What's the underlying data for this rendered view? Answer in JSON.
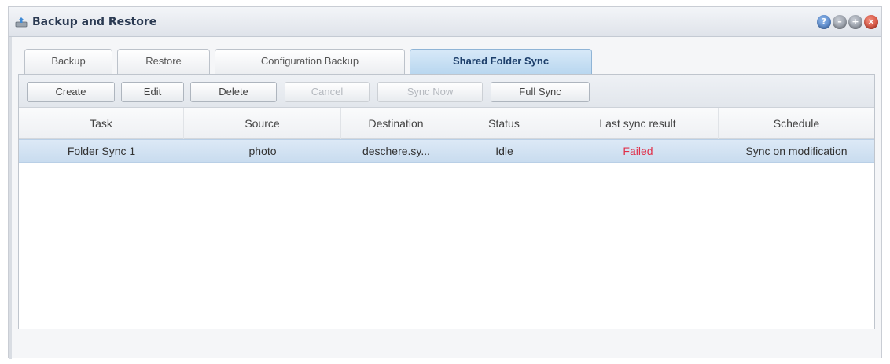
{
  "window": {
    "title": "Backup and Restore"
  },
  "window_buttons": [
    {
      "name": "help-button",
      "glyph": "?"
    },
    {
      "name": "minimize-button",
      "glyph": "–"
    },
    {
      "name": "maximize-button",
      "glyph": "+"
    },
    {
      "name": "close-button",
      "glyph": "×"
    }
  ],
  "tabs": [
    {
      "label": "Backup",
      "active": false
    },
    {
      "label": "Restore",
      "active": false
    },
    {
      "label": "Configuration Backup",
      "active": false
    },
    {
      "label": "Shared Folder Sync",
      "active": true
    }
  ],
  "toolbar": {
    "create": "Create",
    "edit": "Edit",
    "delete": "Delete",
    "cancel": "Cancel",
    "sync_now": "Sync Now",
    "full_sync": "Full Sync"
  },
  "table": {
    "columns": [
      "Task",
      "Source",
      "Destination",
      "Status",
      "Last sync result",
      "Schedule"
    ],
    "rows": [
      [
        "Folder Sync 1",
        "photo",
        "deschere.sy...",
        "Idle",
        "Failed",
        "Sync on modification"
      ]
    ]
  },
  "colors": {
    "failed": "#e0304a",
    "selected_row": "#c9dcef",
    "active_tab": "#b8d6ef"
  }
}
